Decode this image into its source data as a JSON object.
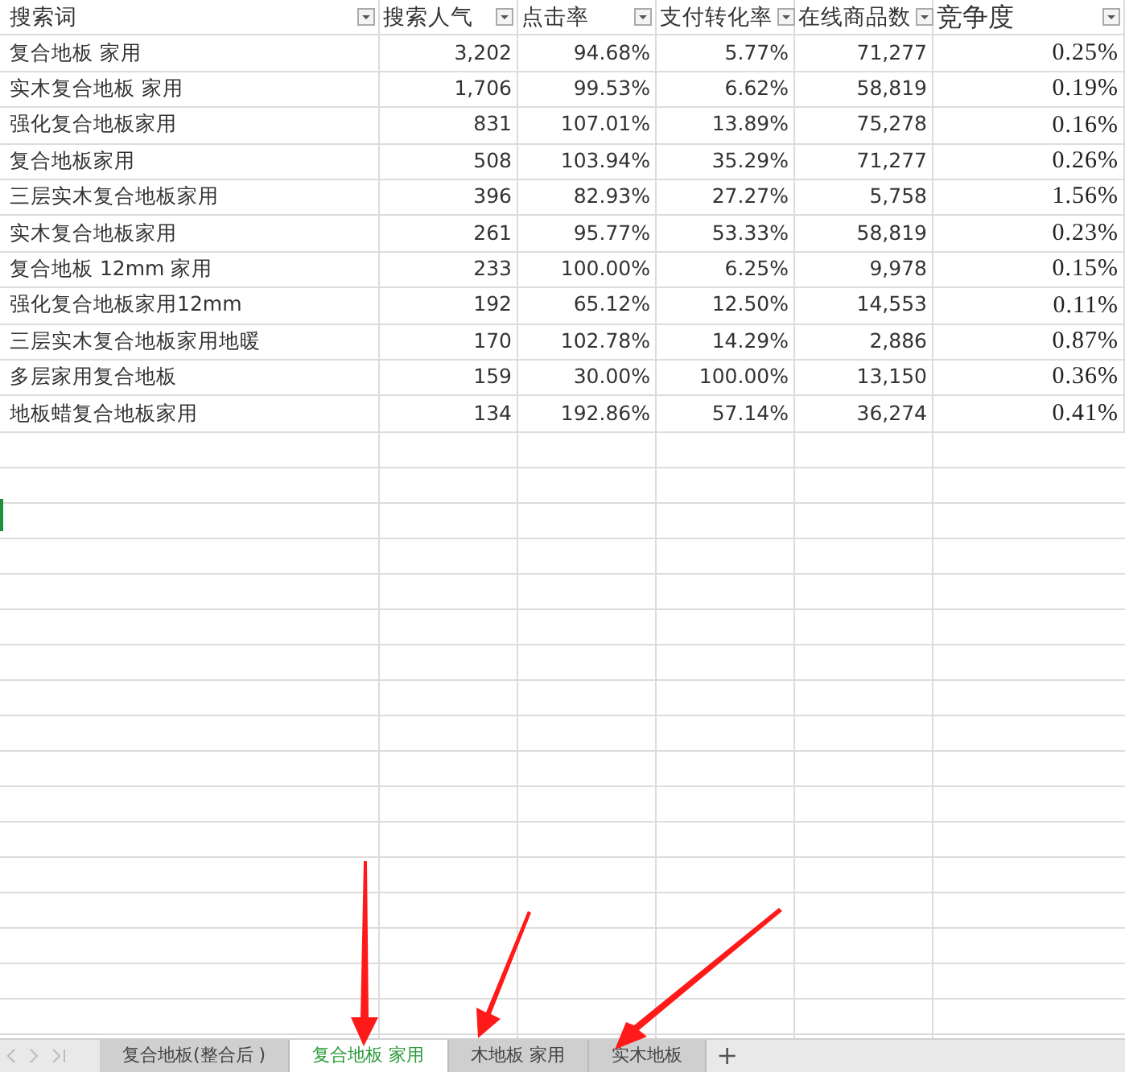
{
  "columns": [
    {
      "label": "搜索词",
      "kind": "text"
    },
    {
      "label": "搜索人气",
      "kind": "number"
    },
    {
      "label": "点击率",
      "kind": "number"
    },
    {
      "label": "支付转化率",
      "kind": "number"
    },
    {
      "label": "在线商品数",
      "kind": "number"
    },
    {
      "label": "竞争度",
      "kind": "ratio"
    }
  ],
  "rows": [
    [
      "复合地板 家用",
      "3,202",
      "94.68%",
      "5.77%",
      "71,277",
      "0.25%"
    ],
    [
      "实木复合地板 家用",
      "1,706",
      "99.53%",
      "6.62%",
      "58,819",
      "0.19%"
    ],
    [
      "强化复合地板家用",
      "831",
      "107.01%",
      "13.89%",
      "75,278",
      "0.16%"
    ],
    [
      "复合地板家用",
      "508",
      "103.94%",
      "35.29%",
      "71,277",
      "0.26%"
    ],
    [
      "三层实木复合地板家用",
      "396",
      "82.93%",
      "27.27%",
      "5,758",
      "1.56%"
    ],
    [
      "实木复合地板家用",
      "261",
      "95.77%",
      "53.33%",
      "58,819",
      "0.23%"
    ],
    [
      "复合地板 12mm 家用",
      "233",
      "100.00%",
      "6.25%",
      "9,978",
      "0.15%"
    ],
    [
      "强化复合地板家用12mm",
      "192",
      "65.12%",
      "12.50%",
      "14,553",
      "0.11%"
    ],
    [
      "三层实木复合地板家用地暖",
      "170",
      "102.78%",
      "14.29%",
      "2,886",
      "0.87%"
    ],
    [
      "多层家用复合地板",
      "159",
      "30.00%",
      "100.00%",
      "13,150",
      "0.36%"
    ],
    [
      "地板蜡复合地板家用",
      "134",
      "192.86%",
      "57.14%",
      "36,274",
      "0.41%"
    ]
  ],
  "sheet_tabs": [
    {
      "label": "复合地板(整合后 )",
      "selected": false
    },
    {
      "label": "复合地板 家用",
      "selected": true
    },
    {
      "label": "木地板 家用",
      "selected": false
    },
    {
      "label": "实木地板",
      "selected": false
    }
  ],
  "add_sheet": "+"
}
